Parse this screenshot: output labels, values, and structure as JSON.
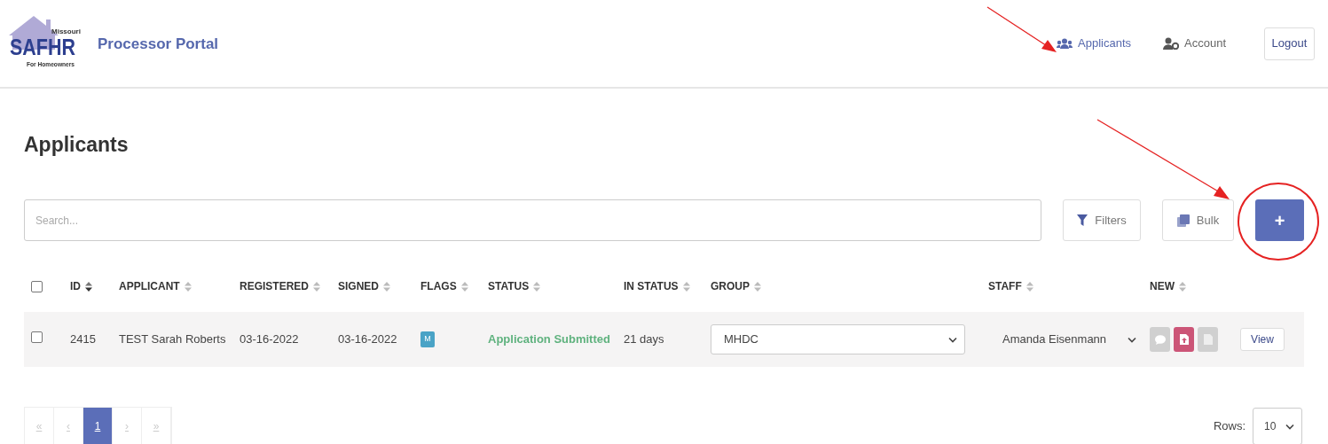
{
  "header": {
    "logo": {
      "top": "Missouri",
      "main": "SAFHR",
      "bottom": "For Homeowners"
    },
    "portal_title": "Processor Portal",
    "nav": [
      {
        "kind": "applicants",
        "label": "Applicants",
        "selected": true
      },
      {
        "kind": "account",
        "label": "Account",
        "selected": false
      }
    ],
    "logout": "Logout"
  },
  "page_title": "Applicants",
  "toolbar": {
    "search": {
      "placeholder": "Search..."
    },
    "filters": "Filters",
    "bulk": "Bulk",
    "add": "+"
  },
  "table": {
    "select_all": {
      "checked": false
    },
    "columns": [
      {
        "label": "ID",
        "sorted": true
      },
      {
        "label": "APPLICANT",
        "sorted": false
      },
      {
        "label": "REGISTERED",
        "sorted": false
      },
      {
        "label": "SIGNED",
        "sorted": false
      },
      {
        "label": "FLAGS",
        "sorted": false
      },
      {
        "label": "STATUS",
        "sorted": false
      },
      {
        "label": "IN STATUS",
        "sorted": false
      },
      {
        "label": "GROUP",
        "sorted": false
      },
      {
        "label": "STAFF",
        "sorted": false
      },
      {
        "label": "NEW",
        "sorted": false
      }
    ],
    "rows": [
      {
        "checked": false,
        "id": "2415",
        "applicant": "TEST Sarah Roberts",
        "registered": "03-16-2022",
        "signed": "03-16-2022",
        "flags": [
          "M"
        ],
        "status": "Application Submitted",
        "in_status": "21 days",
        "group": "MHDC",
        "staff": "Amanda Eisenmann",
        "new_items": [
          {
            "kind": "comment",
            "active": false
          },
          {
            "kind": "upload",
            "active": true
          },
          {
            "kind": "document",
            "active": false
          }
        ],
        "action": "View"
      }
    ]
  },
  "pagination": [
    {
      "label": "«",
      "selected": false,
      "disabled": true
    },
    {
      "label": "‹",
      "selected": false,
      "disabled": true
    },
    {
      "label": "1",
      "selected": true,
      "disabled": false
    },
    {
      "label": "›",
      "selected": false,
      "disabled": true
    },
    {
      "label": "»",
      "selected": false,
      "disabled": true
    }
  ],
  "rows_per_page": {
    "label": "Rows:",
    "value": "10"
  }
}
